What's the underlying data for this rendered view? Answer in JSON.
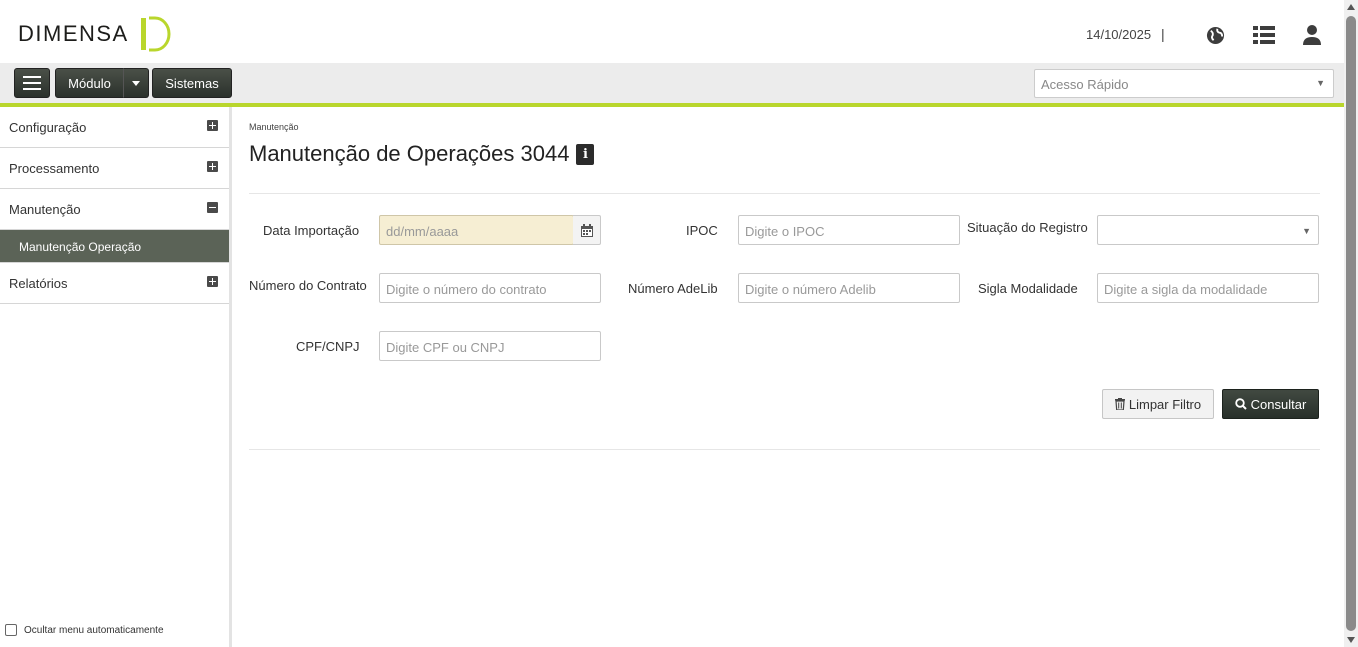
{
  "header": {
    "brand": "DIMENSA",
    "date": "14/10/2025",
    "separator": "|",
    "icons": [
      "globe-icon",
      "list-icon",
      "user-icon"
    ]
  },
  "toolbar": {
    "modulo_label": "Módulo",
    "sistemas_label": "Sistemas",
    "quick_access_placeholder": "Acesso Rápido"
  },
  "sidebar": {
    "items": [
      {
        "label": "Configuração",
        "state": "collapsed"
      },
      {
        "label": "Processamento",
        "state": "collapsed"
      },
      {
        "label": "Manutenção",
        "state": "expanded"
      },
      {
        "label": "Relatórios",
        "state": "collapsed"
      }
    ],
    "sub_item": "Manutenção Operação",
    "hide_menu_label": "Ocultar menu automaticamente"
  },
  "main": {
    "breadcrumb": "Manutenção",
    "title": "Manutenção de Operações 3044",
    "info": "i",
    "fields": {
      "data_importacao": {
        "label": "Data Importação",
        "placeholder": "dd/mm/aaaa"
      },
      "ipoc": {
        "label": "IPOC",
        "placeholder": "Digite o IPOC"
      },
      "situacao": {
        "label": "Situação do Registro",
        "value": ""
      },
      "numero_contrato": {
        "label": "Número do Contrato",
        "placeholder": "Digite o número do contrato"
      },
      "numero_adelib": {
        "label": "Número AdeLib",
        "placeholder": "Digite o número Adelib"
      },
      "sigla_modalidade": {
        "label": "Sigla Modalidade",
        "placeholder": "Digite a sigla da modalidade"
      },
      "cpf_cnpj": {
        "label": "CPF/CNPJ",
        "placeholder": "Digite CPF ou CNPJ"
      }
    },
    "buttons": {
      "clear": "Limpar Filtro",
      "search": "Consultar"
    }
  },
  "colors": {
    "accent": "#b9d62c",
    "dark_button": "#2b312c",
    "sidebar_selected": "#5b6357",
    "date_field_bg": "#f6eed3"
  }
}
